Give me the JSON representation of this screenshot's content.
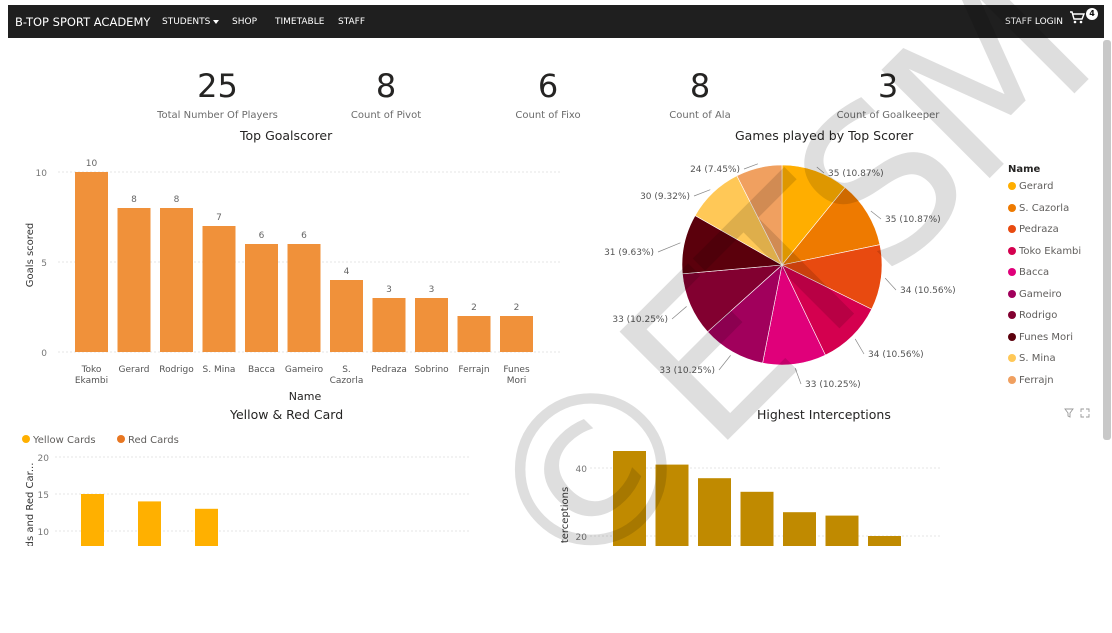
{
  "nav": {
    "brand": "B-TOP SPORT ACADEMY",
    "items": [
      "STUDENTS",
      "SHOP",
      "TIMETABLE",
      "STAFF"
    ],
    "login": "STAFF LOGIN",
    "cart_count": "4"
  },
  "kpis": [
    {
      "value": "25",
      "label": "Total Number Of Players"
    },
    {
      "value": "8",
      "label": "Count of Pivot"
    },
    {
      "value": "6",
      "label": "Count of Fixo"
    },
    {
      "value": "8",
      "label": "Count of Ala"
    },
    {
      "value": "3",
      "label": "Count of Goalkeeper"
    }
  ],
  "watermark": "©ETSM",
  "colors": {
    "bar_orange": "#f0913a",
    "yellow": "#ffb000",
    "red_orange": "#e87722",
    "interceptions": "#c08a00"
  },
  "chart_data": [
    {
      "type": "bar",
      "title": "Top Goalscorer",
      "xlabel": "Name",
      "ylabel": "Goals scored",
      "categories": [
        "Toko Ekambi",
        "Gerard",
        "Rodrigo",
        "S. Mina",
        "Bacca",
        "Gameiro",
        "S. Cazorla",
        "Pedraza",
        "Sobrino",
        "Ferrajn",
        "Funes Mori"
      ],
      "values": [
        10,
        8,
        8,
        7,
        6,
        6,
        4,
        3,
        3,
        2,
        2
      ],
      "ylim": [
        0,
        11
      ],
      "yticks": [
        0,
        5,
        10
      ],
      "grid": true
    },
    {
      "type": "pie",
      "title": "Games played by Top Scorer",
      "legend_title": "Name",
      "legend_position": "right",
      "slices": [
        {
          "name": "Gerard",
          "value": 35,
          "label": "35 (10.87%)",
          "color": "#ffae00"
        },
        {
          "name": "S. Cazorla",
          "value": 35,
          "label": "35 (10.87%)",
          "color": "#ee7a00"
        },
        {
          "name": "Pedraza",
          "value": 34,
          "label": "34 (10.56%)",
          "color": "#e84a10"
        },
        {
          "name": "Toko Ekambi",
          "value": 34,
          "label": "34 (10.56%)",
          "color": "#d4004f"
        },
        {
          "name": "Bacca",
          "value": 33,
          "label": "33 (10.25%)",
          "color": "#e0007a"
        },
        {
          "name": "Gameiro",
          "value": 33,
          "label": "33 (10.25%)",
          "color": "#a1005c"
        },
        {
          "name": "Rodrigo",
          "value": 33,
          "label": "33 (10.25%)",
          "color": "#820030"
        },
        {
          "name": "Funes Mori",
          "value": 31,
          "label": "31 (9.63%)",
          "color": "#5b000c"
        },
        {
          "name": "S. Mina",
          "value": 30,
          "label": "30 (9.32%)",
          "color": "#ffc857"
        },
        {
          "name": "Ferrajn",
          "value": 24,
          "label": "24 (7.45%)",
          "color": "#f0a060"
        }
      ]
    },
    {
      "type": "bar",
      "title": "Yellow & Red Card",
      "legend": [
        "Yellow Cards",
        "Red Cards"
      ],
      "legend_position": "top-left",
      "ylabel": "ds and Red Car...",
      "yticks": [
        10,
        15,
        20
      ],
      "series": [
        {
          "name": "Yellow Cards",
          "values": [
            15,
            14,
            13
          ]
        }
      ]
    },
    {
      "type": "bar",
      "title": "Highest Interceptions",
      "ylabel": "terceptions",
      "yticks": [
        20,
        40
      ],
      "values": [
        45,
        41,
        37,
        33,
        27,
        26,
        20
      ]
    }
  ]
}
